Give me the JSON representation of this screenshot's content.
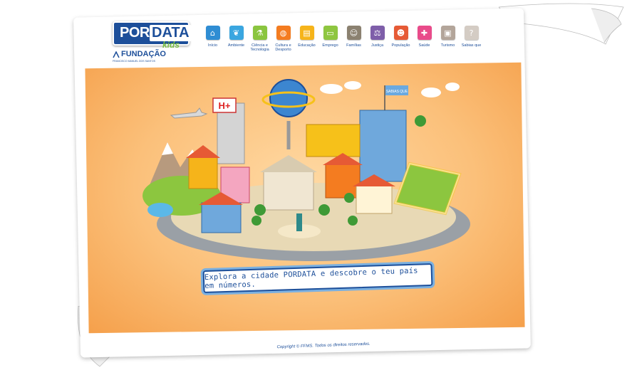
{
  "logo": {
    "part1": "POR",
    "part2": "DATA",
    "sub": "kids"
  },
  "fundacao": {
    "name": "FUNDAÇÃO",
    "sub": "FRANCISCO MANUEL DOS SANTOS"
  },
  "nav": [
    {
      "label": "Início",
      "color": "#2f8dd3",
      "icon": "home-icon",
      "glyph": "⌂"
    },
    {
      "label": "Ambiente",
      "color": "#3aa6e0",
      "icon": "leaf-icon",
      "glyph": "❦"
    },
    {
      "label": "Ciência e Tecnologia",
      "color": "#8ac53f",
      "icon": "microscope-icon",
      "glyph": "⚗"
    },
    {
      "label": "Cultura e Desporto",
      "color": "#f47c20",
      "icon": "ball-icon",
      "glyph": "◍"
    },
    {
      "label": "Educação",
      "color": "#f6b41a",
      "icon": "book-icon",
      "glyph": "▤"
    },
    {
      "label": "Emprego",
      "color": "#8ec640",
      "icon": "briefcase-icon",
      "glyph": "▭"
    },
    {
      "label": "Famílias",
      "color": "#8b8170",
      "icon": "family-icon",
      "glyph": "☺"
    },
    {
      "label": "Justiça",
      "color": "#7e5ea9",
      "icon": "scales-icon",
      "glyph": "⚖"
    },
    {
      "label": "População",
      "color": "#e65a35",
      "icon": "person-icon",
      "glyph": "☻"
    },
    {
      "label": "Saúde",
      "color": "#e94b8a",
      "icon": "health-icon",
      "glyph": "✚"
    },
    {
      "label": "Turismo",
      "color": "#b3a59a",
      "icon": "luggage-icon",
      "glyph": "▣"
    },
    {
      "label": "Sabias que",
      "color": "#d4ccc4",
      "icon": "question-icon",
      "glyph": "?"
    }
  ],
  "city": {
    "hospital_sign": "H+",
    "flag_text": "SABIAS QUE"
  },
  "banner": {
    "text": "Explora a cidade PORDATA e descobre o teu país em números."
  },
  "footer": {
    "text": "Copyright © FFMS. Todos os direitos reservados."
  },
  "colors": {
    "brand": "#1d4f9a",
    "orange": "#f5a04b",
    "green": "#7bc143"
  }
}
